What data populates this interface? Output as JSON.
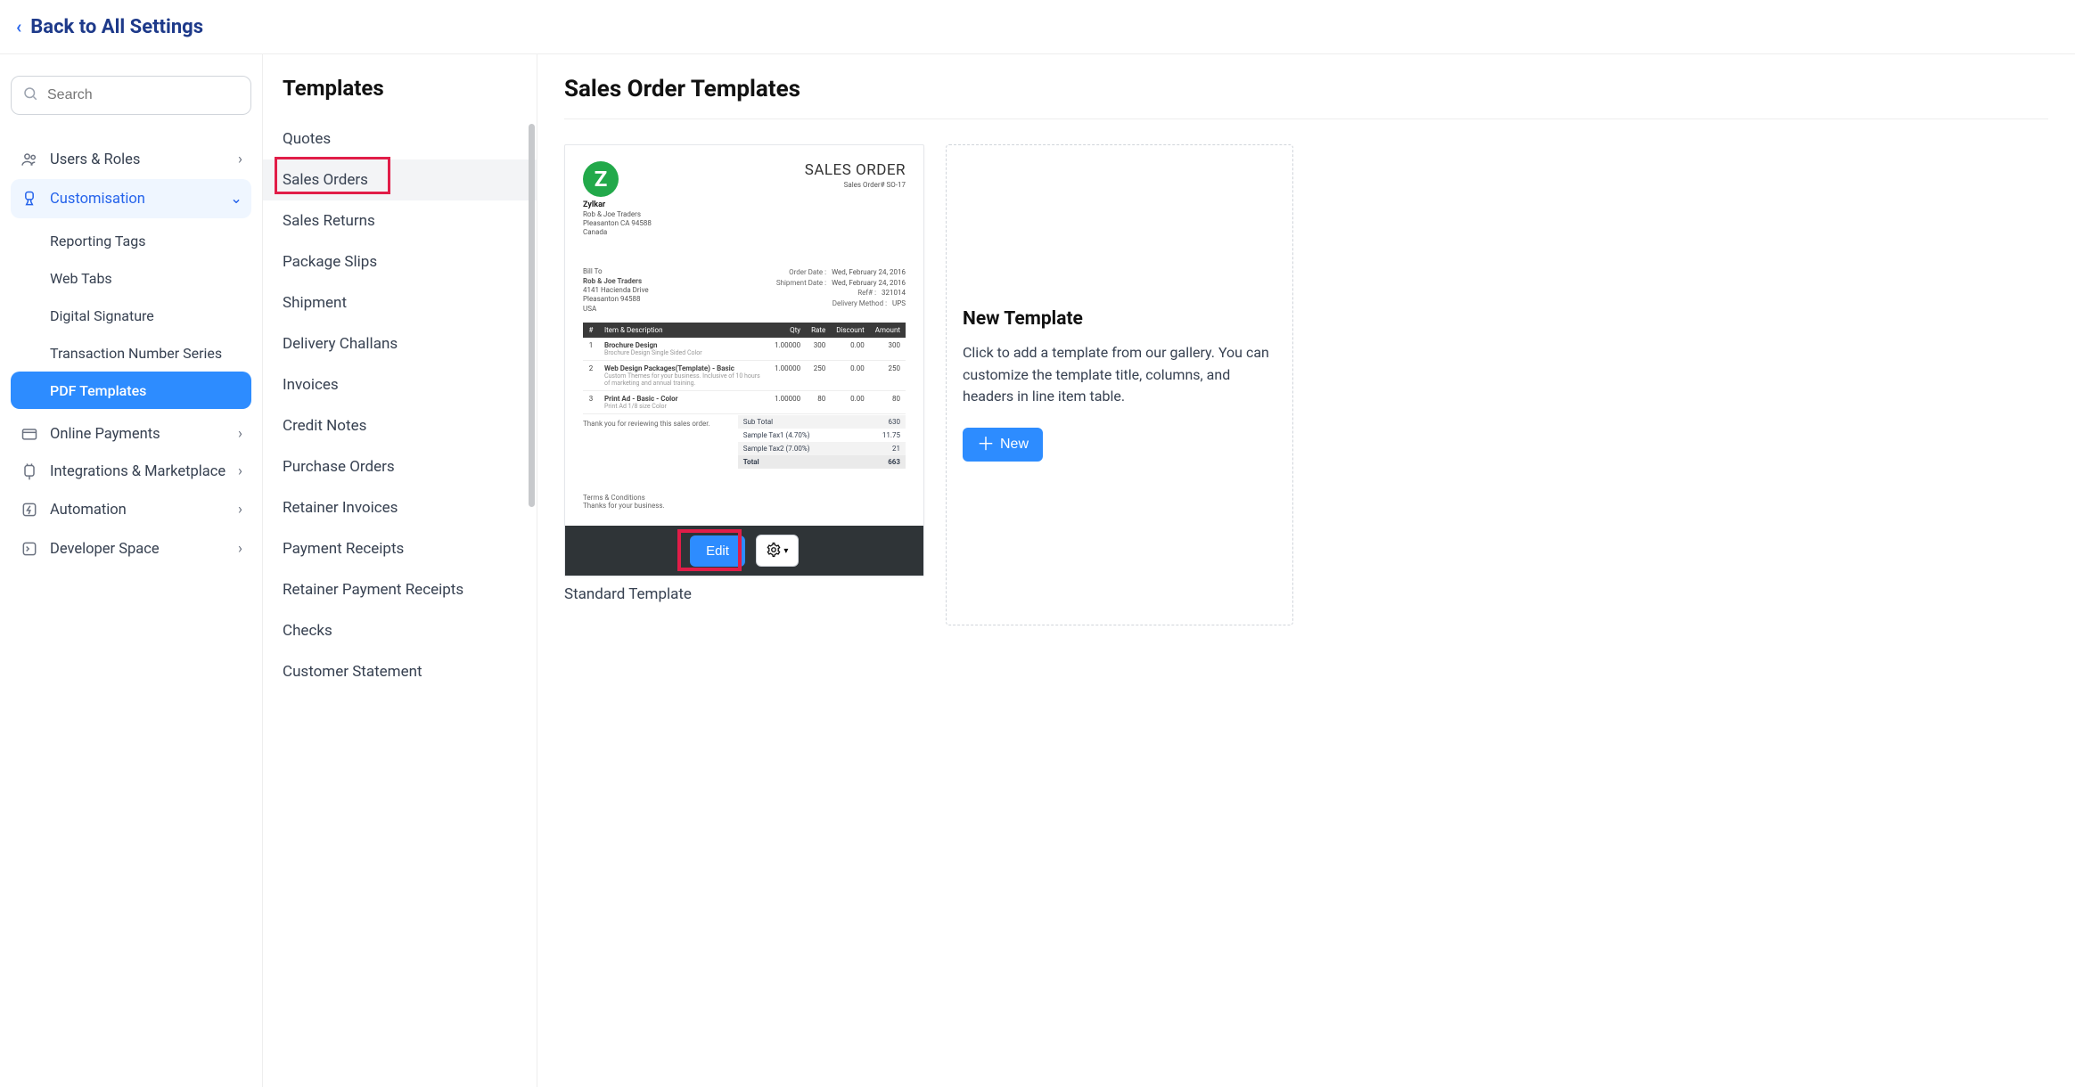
{
  "back_label": "Back to All Settings",
  "search": {
    "placeholder": "Search"
  },
  "sidebar": {
    "items": [
      {
        "label": "Users & Roles",
        "icon": "users-icon",
        "expandable": true
      },
      {
        "label": "Customisation",
        "icon": "brush-icon",
        "expandable": true,
        "active": true
      },
      {
        "label": "Online Payments",
        "icon": "card-icon",
        "expandable": true
      },
      {
        "label": "Integrations & Marketplace",
        "icon": "plug-icon",
        "expandable": true
      },
      {
        "label": "Automation",
        "icon": "bolt-icon",
        "expandable": true
      },
      {
        "label": "Developer Space",
        "icon": "terminal-icon",
        "expandable": true
      }
    ],
    "customisation_subitems": [
      {
        "label": "Reporting Tags"
      },
      {
        "label": "Web Tabs"
      },
      {
        "label": "Digital Signature"
      },
      {
        "label": "Transaction Number Series"
      },
      {
        "label": "PDF Templates",
        "selected": true
      }
    ]
  },
  "templates": {
    "heading": "Templates",
    "items": [
      "Quotes",
      "Sales Orders",
      "Sales Returns",
      "Package Slips",
      "Shipment",
      "Delivery Challans",
      "Invoices",
      "Credit Notes",
      "Purchase Orders",
      "Retainer Invoices",
      "Payment Receipts",
      "Retainer Payment Receipts",
      "Checks",
      "Customer Statement"
    ],
    "selected": "Sales Orders"
  },
  "main": {
    "heading": "Sales Order Templates",
    "preview": {
      "company_name": "Zylkar",
      "company_line1": "Rob & Joe Traders",
      "company_line2": "Pleasanton CA 94588",
      "company_line3": "Canada",
      "doc_title": "SALES ORDER",
      "doc_number": "Sales Order# SO-17",
      "bill_to_label": "Bill To",
      "bill_to_name": "Rob & Joe Traders",
      "bill_to_line1": "4141 Hacienda Drive",
      "bill_to_line2": "Pleasanton 94588",
      "bill_to_line3": "USA",
      "meta": [
        {
          "l": "Order Date :",
          "v": "Wed, February 24, 2016"
        },
        {
          "l": "Shipment Date :",
          "v": "Wed, February 24, 2016"
        },
        {
          "l": "Ref# :",
          "v": "321014"
        },
        {
          "l": "Delivery Method :",
          "v": "UPS"
        }
      ],
      "columns": [
        "#",
        "Item & Description",
        "Qty",
        "Rate",
        "Discount",
        "Amount"
      ],
      "rows": [
        {
          "n": "1",
          "item": "Brochure Design",
          "sub": "Brochure Design Single Sided Color",
          "qty": "1.00000",
          "rate": "300",
          "disc": "0.00",
          "amt": "300"
        },
        {
          "n": "2",
          "item": "Web Design Packages(Template) - Basic",
          "sub": "Custom Themes for your business. Inclusive of 10 hours of marketing and annual training.",
          "qty": "1.00000",
          "rate": "250",
          "disc": "0.00",
          "amt": "250"
        },
        {
          "n": "3",
          "item": "Print Ad - Basic - Color",
          "sub": "Print Ad 1/8 size Color",
          "qty": "1.00000",
          "rate": "80",
          "disc": "0.00",
          "amt": "80"
        }
      ],
      "thanks_line": "Thank you for reviewing this sales order.",
      "totals": [
        {
          "l": "Sub Total",
          "v": "630"
        },
        {
          "l": "Sample Tax1 (4.70%)",
          "v": "11.75"
        },
        {
          "l": "Sample Tax2 (7.00%)",
          "v": "21"
        },
        {
          "l": "Total",
          "v": "663",
          "total": true
        }
      ],
      "terms_label": "Terms & Conditions",
      "terms_text": "Thanks for your business."
    },
    "edit_label": "Edit",
    "template_caption": "Standard Template",
    "new_card": {
      "title": "New Template",
      "body": "Click to add a template from our gallery. You can customize the template title, columns, and headers in line item table.",
      "button": "New"
    }
  }
}
